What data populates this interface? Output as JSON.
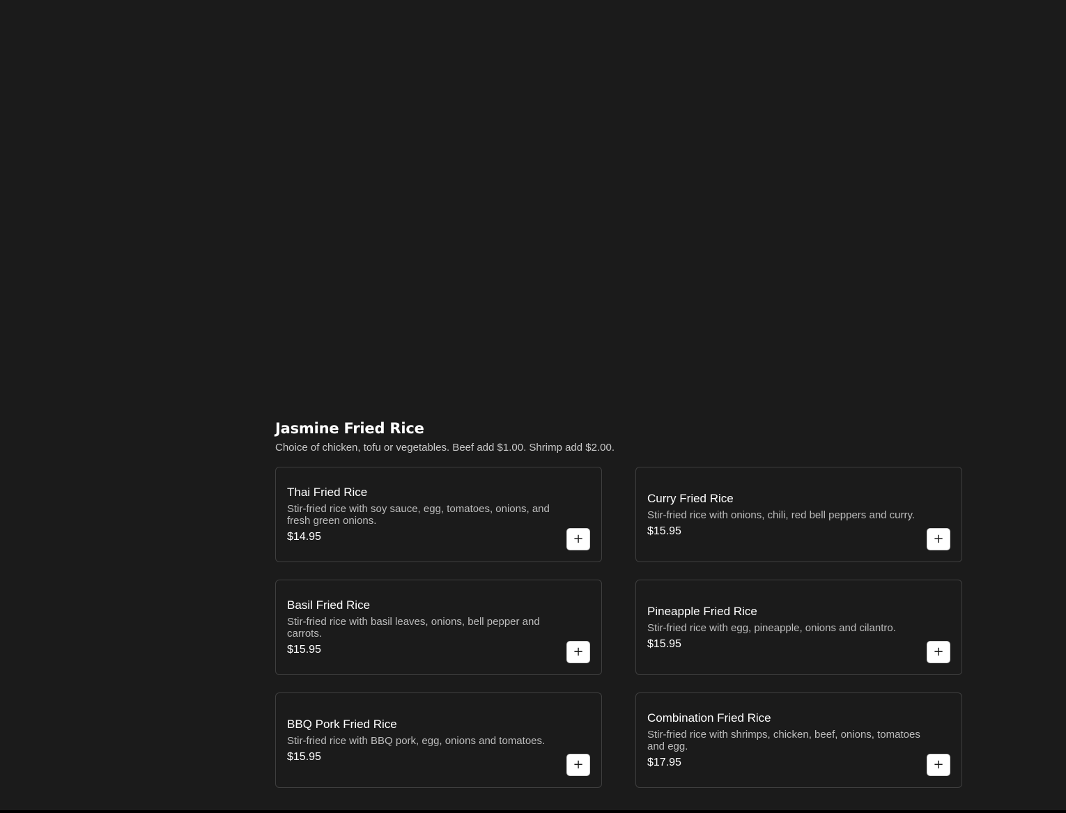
{
  "section": {
    "title": "Jasmine Fried Rice",
    "description": "Choice of chicken, tofu or vegetables. Beef add $1.00. Shrimp add $2.00."
  },
  "items": [
    {
      "name": "Thai Fried Rice",
      "description": "Stir-fried rice with soy sauce, egg, tomatoes, onions, and fresh green onions.",
      "price": "$14.95",
      "add_label": "+"
    },
    {
      "name": "Curry Fried Rice",
      "description": "Stir-fried rice with onions, chili, red bell peppers and curry.",
      "price": "$15.95",
      "add_label": "+"
    },
    {
      "name": "Basil Fried Rice",
      "description": "Stir-fried rice with basil leaves, onions, bell pepper and carrots.",
      "price": "$15.95",
      "add_label": "+"
    },
    {
      "name": "Pineapple Fried Rice",
      "description": "Stir-fried rice with egg, pineapple, onions and cilantro.",
      "price": "$15.95",
      "add_label": "+"
    },
    {
      "name": "BBQ Pork Fried Rice",
      "description": "Stir-fried rice with BBQ pork, egg, onions and tomatoes.",
      "price": "$15.95",
      "add_label": "+"
    },
    {
      "name": "Combination Fried Rice",
      "description": "Stir-fried rice with shrimps, chicken, beef, onions, tomatoes and egg.",
      "price": "$17.95",
      "add_label": "+"
    }
  ],
  "colors": {
    "background": "#1b1b1b",
    "card_border": "#3f3f3f",
    "text_primary": "#ffffff",
    "text_secondary": "#bdbdbd",
    "button_bg": "#ffffff"
  }
}
